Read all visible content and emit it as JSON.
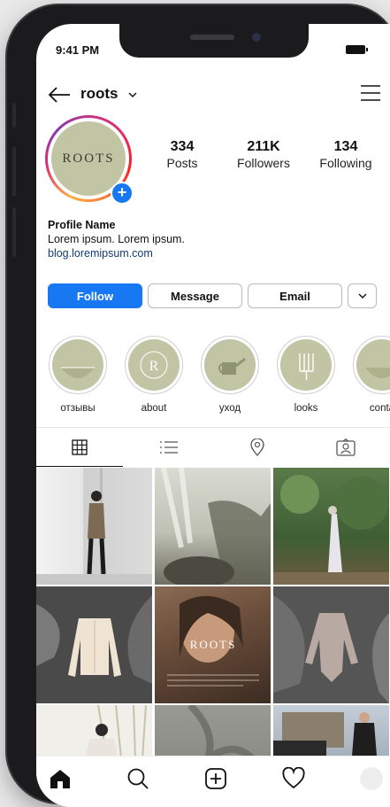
{
  "status": {
    "time": "9:41 PM"
  },
  "header": {
    "username": "roots",
    "chevron": "⌄"
  },
  "profile": {
    "avatar_text": "ROOTS",
    "stats": [
      {
        "value": "334",
        "label": "Posts"
      },
      {
        "value": "211K",
        "label": "Followers"
      },
      {
        "value": "134",
        "label": "Following"
      }
    ],
    "name": "Profile Name",
    "bio": "Lorem ipsum. Lorem ipsum.",
    "link": "blog.loremipsum.com"
  },
  "actions": {
    "follow": "Follow",
    "message": "Message",
    "email": "Email"
  },
  "highlights": [
    {
      "label": "отзывы"
    },
    {
      "label": "about"
    },
    {
      "label": "уход"
    },
    {
      "label": "looks"
    },
    {
      "label": "conta"
    }
  ],
  "posts": {
    "caption_logo": "ROOTS"
  },
  "colors": {
    "accent": "#1877f2",
    "sage": "#c2c5a4"
  },
  "icons": [
    "back-arrow-icon",
    "menu-icon",
    "grid-icon",
    "list-icon",
    "location-pin-icon",
    "tagged-icon",
    "home-icon",
    "search-icon",
    "new-post-icon",
    "heart-icon"
  ]
}
